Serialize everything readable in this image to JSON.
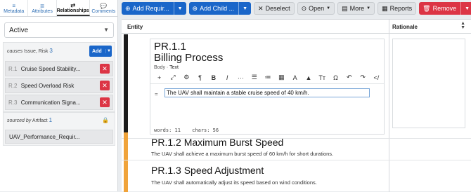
{
  "sidebar": {
    "tabs": [
      {
        "label": "Metadata",
        "icon": "≡"
      },
      {
        "label": "Attributes",
        "icon": "≣"
      },
      {
        "label": "Relationships",
        "icon": "⇄"
      },
      {
        "label": "Comments",
        "icon": "💬"
      }
    ],
    "status_value": "Active",
    "causes": {
      "prefix": "causes",
      "types": "Issue, Risk",
      "count": "3",
      "add_label": "Add",
      "items": [
        {
          "id": "R.1",
          "name": "Cruise Speed Stability..."
        },
        {
          "id": "R.2",
          "name": "Speed Overload Risk"
        },
        {
          "id": "R.3",
          "name": "Communication Signa..."
        }
      ]
    },
    "sourced": {
      "prefix": "sourced by",
      "types": "Artifact",
      "count": "1",
      "items": [
        "UAV_Performance_Requir..."
      ]
    }
  },
  "toolbar": {
    "add_requirement": "Add Requir...",
    "add_child": "Add Child ...",
    "deselect": "Deselect",
    "open": "Open",
    "more": "More",
    "reports": "Reports",
    "remove": "Remove"
  },
  "table": {
    "col_entity": "Entity",
    "col_rationale": "Rationale",
    "editor": {
      "id": "PR.1.1",
      "title": "Billing Process",
      "field_label": "Body",
      "field_mode": "Text",
      "content": "The UAV shall maintain a stable cruise speed of 40 km/h.",
      "words_label": "words: 11",
      "chars_label": "chars: 56"
    },
    "rows": [
      {
        "title": "PR.1.2 Maximum Burst Speed",
        "text": "The UAV shall achieve a maximum burst speed of 60 km/h for short durations."
      },
      {
        "title": "PR.1.3 Speed Adjustment",
        "text": "The UAV shall automatically adjust its speed based on wind conditions."
      }
    ]
  },
  "colors": {
    "primary": "#1a66c9",
    "danger": "#dc3545",
    "row_bar_selected": "#1c1c1c",
    "row_bar": "#f0a33a"
  }
}
